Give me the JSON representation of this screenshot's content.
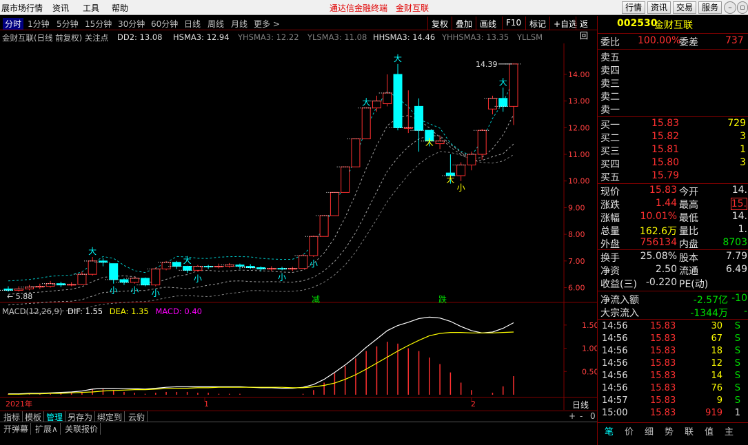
{
  "titlebar": {
    "menus": [
      "展市场行情",
      "资讯",
      "工具",
      "帮助"
    ],
    "center_links": [
      "通达信金融终端",
      "金财互联"
    ],
    "right_buttons": [
      "行情",
      "资讯",
      "交易",
      "服务"
    ]
  },
  "periodbar": {
    "periods": [
      "分时",
      "1分钟",
      "5分钟",
      "15分钟",
      "30分钟",
      "60分钟",
      "日线",
      "周线",
      "月线",
      "更多 >"
    ],
    "active": "分时",
    "right_buttons": [
      "复权",
      "叠加",
      "画线",
      "F10",
      "标记",
      "+自选",
      "返回"
    ]
  },
  "indicator_bar": {
    "name": "金财互联(日线 前复权) 关注点",
    "dd2": "DD2: 13.08",
    "hsma3": "HSMA3: 12.94",
    "yhsma3": "YHSMA3: 12.22",
    "ylsma3": "YLSMA3: 11.08",
    "hhsma3": "HHSMA3: 14.46",
    "yhhsma3": "YHHSMA3: 13.35",
    "yllsm": "YLLSM"
  },
  "price_axis": [
    "14.00",
    "13.00",
    "12.00",
    "11.00",
    "10.00",
    "9.00",
    "8.00",
    "7.00",
    "6.00"
  ],
  "price_labels": {
    "high": "14.39",
    "low": "5.88"
  },
  "markers": {
    "da": "大",
    "xiao": "小",
    "jian": "减",
    "die": "跌"
  },
  "macd": {
    "label": "MACD(12,26,9)",
    "dif": "DIF: 1.55",
    "dea": "DEA: 1.35",
    "macd": "MACD: 0.40",
    "axis": [
      "1.50",
      "1.00",
      "0.50"
    ]
  },
  "time_axis": {
    "year": "2021年",
    "m1": "1",
    "m2": "2",
    "period": "日线"
  },
  "bottom_tabs": [
    "指标",
    "模板",
    "管理",
    "另存为",
    "绑定到",
    "云豹"
  ],
  "bottom_active": "管理",
  "status_tabs": [
    "开弹幕",
    "扩展∧",
    "关联报价"
  ],
  "zoom_controls": [
    "+",
    "-",
    "0"
  ],
  "quote": {
    "code": "002530",
    "name": "金财互联",
    "weibi_label": "委比",
    "weibi": "100.00%",
    "weicha_label": "委差",
    "weicha": "737",
    "sells": [
      "卖五",
      "卖四",
      "卖三",
      "卖二",
      "卖一"
    ],
    "buys": [
      {
        "label": "买一",
        "price": "15.83",
        "vol": "729"
      },
      {
        "label": "买二",
        "price": "15.82",
        "vol": "3"
      },
      {
        "label": "买三",
        "price": "15.81",
        "vol": "1"
      },
      {
        "label": "买四",
        "price": "15.80",
        "vol": "3"
      },
      {
        "label": "买五",
        "price": "15.79",
        "vol": ""
      }
    ],
    "stats": [
      {
        "l1": "现价",
        "v1": "15.83",
        "l2": "今开",
        "v2": "14."
      },
      {
        "l1": "涨跌",
        "v1": "1.44",
        "l2": "最高",
        "v2": "15."
      },
      {
        "l1": "涨幅",
        "v1": "10.01%",
        "l2": "最低",
        "v2": "14."
      },
      {
        "l1": "总量",
        "v1": "162.6万",
        "l2": "量比",
        "v2": "1."
      },
      {
        "l1": "外盘",
        "v1": "756134",
        "l2": "内盘",
        "v2": "8703"
      }
    ],
    "stats2": [
      {
        "l1": "换手",
        "v1": "25.08%",
        "l2": "股本",
        "v2": "7.79"
      },
      {
        "l1": "净资",
        "v1": "2.50",
        "l2": "流通",
        "v2": "6.49"
      },
      {
        "l1": "收益(三)",
        "v1": "-0.220",
        "l2": "PE(动)",
        "v2": ""
      }
    ],
    "flow": [
      {
        "label": "净流入额",
        "v": "-2.57亿",
        "v2": "-10"
      },
      {
        "label": "大宗流入",
        "v": "-1344万",
        "v2": "-"
      }
    ],
    "ticks": [
      {
        "t": "14:56",
        "p": "15.83",
        "v": "30",
        "s": "S"
      },
      {
        "t": "14:56",
        "p": "15.83",
        "v": "67",
        "s": "S"
      },
      {
        "t": "14:56",
        "p": "15.83",
        "v": "18",
        "s": "S"
      },
      {
        "t": "14:56",
        "p": "15.83",
        "v": "12",
        "s": "S"
      },
      {
        "t": "14:56",
        "p": "15.83",
        "v": "14",
        "s": "S"
      },
      {
        "t": "14:56",
        "p": "15.83",
        "v": "76",
        "s": "S"
      },
      {
        "t": "14:57",
        "p": "15.83",
        "v": "9",
        "s": "S"
      },
      {
        "t": "15:00",
        "p": "15.83",
        "v": "919",
        "s": "1"
      }
    ],
    "tabs": [
      "笔",
      "价",
      "细",
      "势",
      "联",
      "值",
      "主"
    ]
  },
  "colors": {
    "up": "#ff3030",
    "down": "#00ffff",
    "ma": "#00c8c8",
    "dif": "#ffffff",
    "dea": "#ffff00"
  },
  "chart_data": {
    "type": "candlestick",
    "ylim": [
      5.6,
      14.8
    ],
    "candles": [
      [
        5.95,
        5.9,
        6.05,
        5.85
      ],
      [
        5.9,
        5.95,
        6.05,
        5.85
      ],
      [
        5.95,
        6.02,
        6.1,
        5.9
      ],
      [
        6.02,
        6.05,
        6.15,
        5.95
      ],
      [
        6.05,
        6.15,
        6.25,
        6.0
      ],
      [
        6.15,
        6.1,
        6.22,
        6.02
      ],
      [
        6.1,
        6.12,
        6.2,
        6.05
      ],
      [
        6.12,
        6.5,
        6.6,
        6.1
      ],
      [
        6.5,
        7.0,
        7.15,
        6.45
      ],
      [
        7.0,
        6.95,
        7.1,
        6.8
      ],
      [
        6.9,
        6.3,
        6.4,
        6.15
      ],
      [
        6.3,
        6.2,
        6.35,
        6.1
      ],
      [
        6.2,
        6.35,
        6.4,
        6.15
      ],
      [
        6.35,
        6.1,
        6.38,
        6.05
      ],
      [
        6.1,
        6.7,
        6.75,
        6.05
      ],
      [
        6.7,
        6.95,
        7.0,
        6.65
      ],
      [
        6.95,
        6.8,
        7.0,
        6.7
      ],
      [
        6.8,
        6.65,
        6.82,
        6.55
      ],
      [
        6.65,
        6.8,
        6.85,
        6.6
      ],
      [
        6.8,
        6.78,
        6.85,
        6.7
      ],
      [
        6.78,
        6.8,
        6.9,
        6.72
      ],
      [
        6.8,
        6.85,
        6.92,
        6.75
      ],
      [
        6.85,
        6.8,
        6.9,
        6.7
      ],
      [
        6.8,
        6.75,
        6.88,
        6.7
      ],
      [
        6.75,
        6.7,
        6.8,
        6.6
      ],
      [
        6.7,
        6.72,
        6.8,
        6.62
      ],
      [
        6.72,
        6.7,
        6.78,
        6.65
      ],
      [
        6.7,
        6.72,
        6.78,
        6.62
      ],
      [
        6.72,
        7.2,
        7.25,
        6.7
      ],
      [
        7.2,
        7.92,
        7.95,
        7.15
      ],
      [
        7.92,
        8.7,
        8.72,
        7.92
      ],
      [
        8.7,
        9.57,
        9.57,
        8.7
      ],
      [
        9.57,
        10.53,
        10.53,
        9.57
      ],
      [
        10.53,
        11.58,
        11.58,
        10.53
      ],
      [
        11.58,
        12.74,
        12.74,
        11.58
      ],
      [
        12.74,
        13.0,
        13.2,
        12.6
      ],
      [
        12.9,
        13.3,
        14.0,
        12.8
      ],
      [
        14.0,
        12.0,
        14.39,
        11.9
      ],
      [
        12.0,
        12.0,
        13.4,
        11.8
      ],
      [
        12.8,
        11.9,
        13.1,
        11.1
      ],
      [
        11.9,
        11.5,
        11.7,
        11.3
      ],
      [
        11.4,
        11.5,
        11.7,
        11.2
      ],
      [
        10.3,
        10.2,
        11.0,
        9.9
      ],
      [
        10.2,
        10.6,
        10.7,
        10.0
      ],
      [
        10.6,
        11.0,
        11.1,
        10.4
      ],
      [
        11.0,
        11.9,
        11.95,
        10.8
      ],
      [
        12.7,
        13.1,
        13.2,
        12.5
      ],
      [
        13.1,
        12.8,
        13.5,
        12.6
      ],
      [
        12.8,
        14.39,
        14.39,
        12.1
      ]
    ],
    "macd": {
      "dif": [
        0.02,
        0.02,
        0.03,
        0.03,
        0.04,
        0.05,
        0.06,
        0.08,
        0.12,
        0.14,
        0.14,
        0.13,
        0.13,
        0.12,
        0.14,
        0.16,
        0.17,
        0.17,
        0.17,
        0.17,
        0.17,
        0.17,
        0.17,
        0.16,
        0.15,
        0.15,
        0.14,
        0.14,
        0.16,
        0.22,
        0.33,
        0.48,
        0.64,
        0.82,
        1.02,
        1.2,
        1.38,
        1.49,
        1.56,
        1.64,
        1.67,
        1.65,
        1.58,
        1.47,
        1.38,
        1.33,
        1.35,
        1.43,
        1.55
      ],
      "dea": [
        0.01,
        0.01,
        0.02,
        0.02,
        0.03,
        0.03,
        0.04,
        0.05,
        0.06,
        0.08,
        0.09,
        0.1,
        0.11,
        0.11,
        0.12,
        0.13,
        0.14,
        0.14,
        0.15,
        0.15,
        0.16,
        0.16,
        0.16,
        0.16,
        0.16,
        0.16,
        0.16,
        0.15,
        0.15,
        0.17,
        0.2,
        0.25,
        0.33,
        0.43,
        0.55,
        0.68,
        0.81,
        0.94,
        1.06,
        1.17,
        1.27,
        1.32,
        1.34,
        1.34,
        1.33,
        1.33,
        1.33,
        1.34,
        1.35
      ],
      "hist": [
        0.02,
        0.02,
        0.02,
        0.02,
        0.02,
        0.04,
        0.04,
        0.06,
        0.12,
        0.12,
        0.1,
        0.06,
        0.04,
        0.02,
        0.04,
        0.06,
        0.06,
        0.06,
        0.04,
        0.04,
        0.02,
        0.02,
        0.02,
        0.0,
        0.0,
        0.0,
        0.0,
        0.0,
        0.02,
        0.1,
        0.26,
        0.46,
        0.62,
        0.78,
        0.94,
        1.04,
        1.14,
        1.1,
        1.0,
        0.94,
        0.8,
        0.66,
        0.48,
        0.26,
        0.1,
        0.0,
        0.04,
        0.18,
        0.4
      ],
      "ylim": [
        0,
        1.75
      ]
    }
  }
}
